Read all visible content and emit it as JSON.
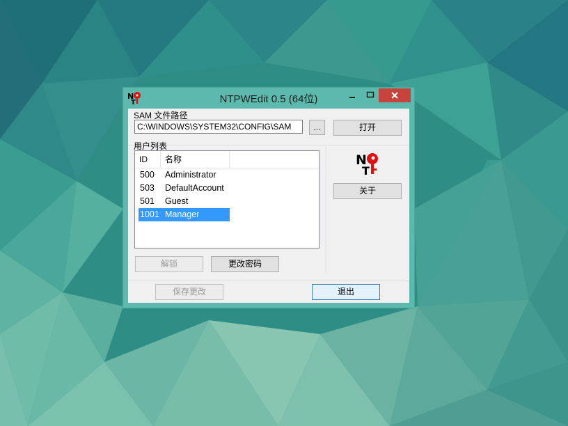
{
  "window": {
    "title": "NTPWEdit 0.5 (64位)"
  },
  "sam": {
    "label": "SAM 文件路径",
    "path_value": "C:\\WINDOWS\\SYSTEM32\\CONFIG\\SAM",
    "browse_label": "...",
    "open_label": "打开"
  },
  "users": {
    "label": "用户列表",
    "columns": [
      "ID",
      "名称"
    ],
    "rows": [
      {
        "id": "500",
        "name": "Administrator"
      },
      {
        "id": "503",
        "name": "DefaultAccount"
      },
      {
        "id": "501",
        "name": "Guest"
      },
      {
        "id": "1001",
        "name": "Manager",
        "selected": true
      }
    ]
  },
  "buttons": {
    "about": "关于",
    "unlock": "解锁",
    "change_password": "更改密码",
    "save_changes": "保存更改",
    "exit": "退出"
  },
  "colors": {
    "titlebar": "#5bb9ad",
    "close_button": "#c7423a",
    "selection": "#3399ff",
    "logo_red": "#e01010"
  }
}
